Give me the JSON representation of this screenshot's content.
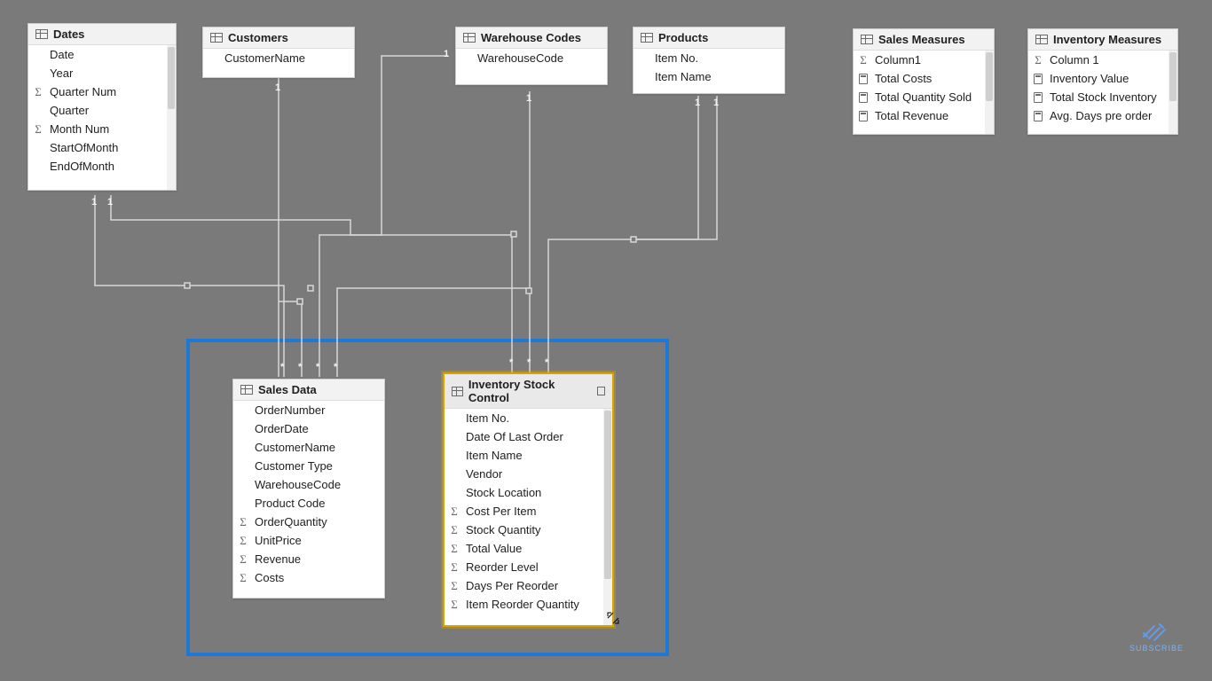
{
  "tables": {
    "dates": {
      "title": "Dates",
      "fields": [
        "Date",
        "Year",
        "Quarter Num",
        "Quarter",
        "Month Num",
        "StartOfMonth",
        "EndOfMonth"
      ],
      "icons": [
        "",
        "",
        "sigma",
        "",
        "sigma",
        "",
        ""
      ]
    },
    "customers": {
      "title": "Customers",
      "fields": [
        "CustomerName"
      ],
      "icons": [
        ""
      ]
    },
    "warehouse": {
      "title": "Warehouse Codes",
      "fields": [
        "WarehouseCode"
      ],
      "icons": [
        ""
      ]
    },
    "products": {
      "title": "Products",
      "fields": [
        "Item No.",
        "Item Name"
      ],
      "icons": [
        "",
        ""
      ]
    },
    "salesMeasures": {
      "title": "Sales Measures",
      "fields": [
        "Column1",
        "Total Costs",
        "Total Quantity Sold",
        "Total Revenue"
      ],
      "icons": [
        "sigma",
        "calc",
        "calc",
        "calc"
      ]
    },
    "inventoryMeasures": {
      "title": "Inventory Measures",
      "fields": [
        "Column 1",
        "Inventory Value",
        "Total Stock Inventory",
        "Avg. Days pre order"
      ],
      "icons": [
        "sigma",
        "calc",
        "calc",
        "calc"
      ]
    },
    "salesData": {
      "title": "Sales Data",
      "fields": [
        "OrderNumber",
        "OrderDate",
        "CustomerName",
        "Customer Type",
        "WarehouseCode",
        "Product Code",
        "OrderQuantity",
        "UnitPrice",
        "Revenue",
        "Costs"
      ],
      "icons": [
        "",
        "",
        "",
        "",
        "",
        "",
        "sigma",
        "sigma",
        "sigma",
        "sigma"
      ]
    },
    "inventory": {
      "title": "Inventory Stock Control",
      "fields": [
        "Item No.",
        "Date Of Last Order",
        "Item Name",
        "Vendor",
        "Stock Location",
        "Cost Per Item",
        "Stock Quantity",
        "Total Value",
        "Reorder Level",
        "Days Per Reorder",
        "Item Reorder Quantity"
      ],
      "icons": [
        "",
        "",
        "",
        "",
        "",
        "sigma",
        "sigma",
        "sigma",
        "sigma",
        "sigma",
        "sigma"
      ]
    }
  },
  "subscribe": "SUBSCRIBE"
}
